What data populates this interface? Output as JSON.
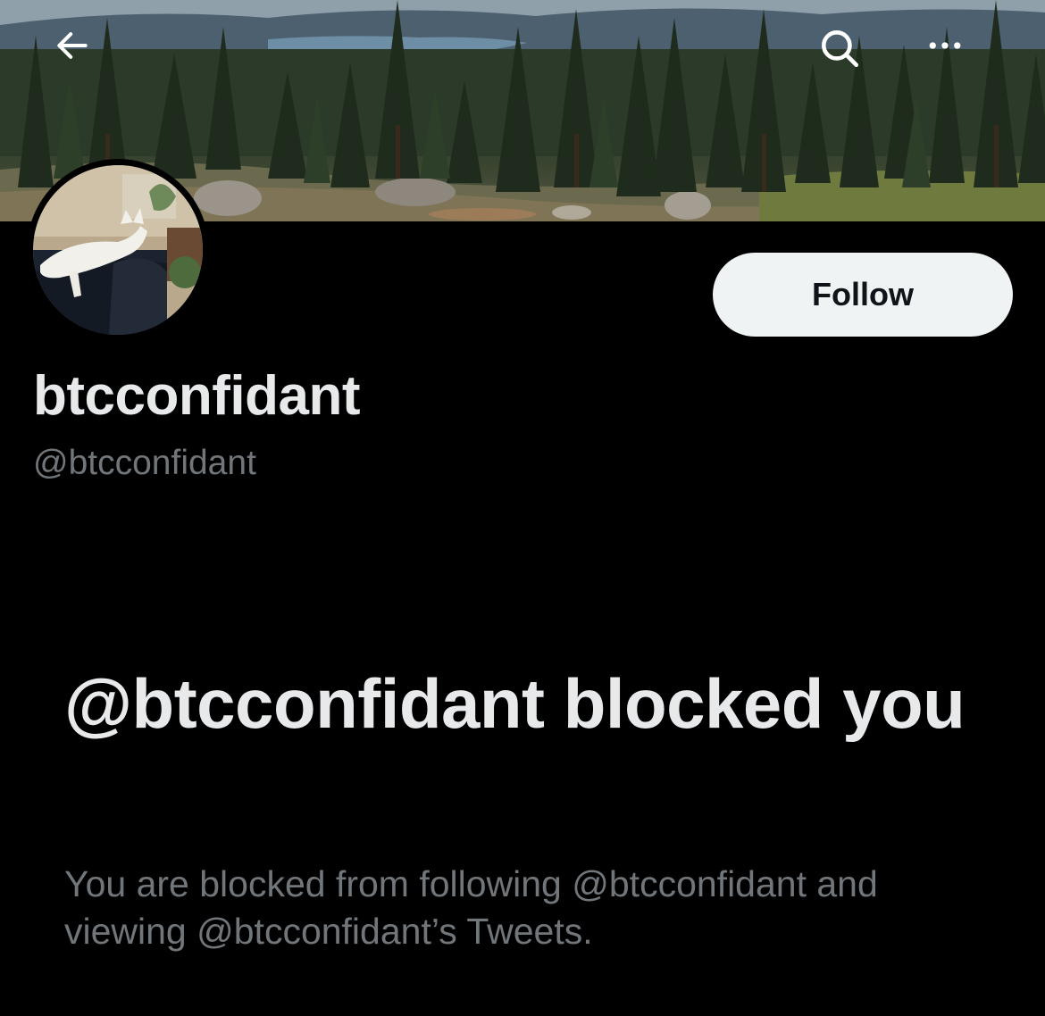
{
  "header": {
    "back_icon": "arrow-left-icon",
    "search_icon": "search-icon",
    "more_icon": "more-horizontal-icon",
    "banner_image": "forest-landscape-with-lake"
  },
  "profile": {
    "avatar_image": "white-dog-on-sofa",
    "follow_label": "Follow",
    "display_name": "btcconfidant",
    "handle": "@btcconfidant"
  },
  "blocked": {
    "title": "@btcconfidant blocked you",
    "description": "You are blocked from following @btcconfidant and viewing @btcconfidant’s Tweets."
  },
  "colors": {
    "background": "#000000",
    "primary_text": "#e7e9ea",
    "secondary_text": "#71767b",
    "follow_button_bg": "#eff3f4",
    "follow_button_text": "#0f1419"
  }
}
